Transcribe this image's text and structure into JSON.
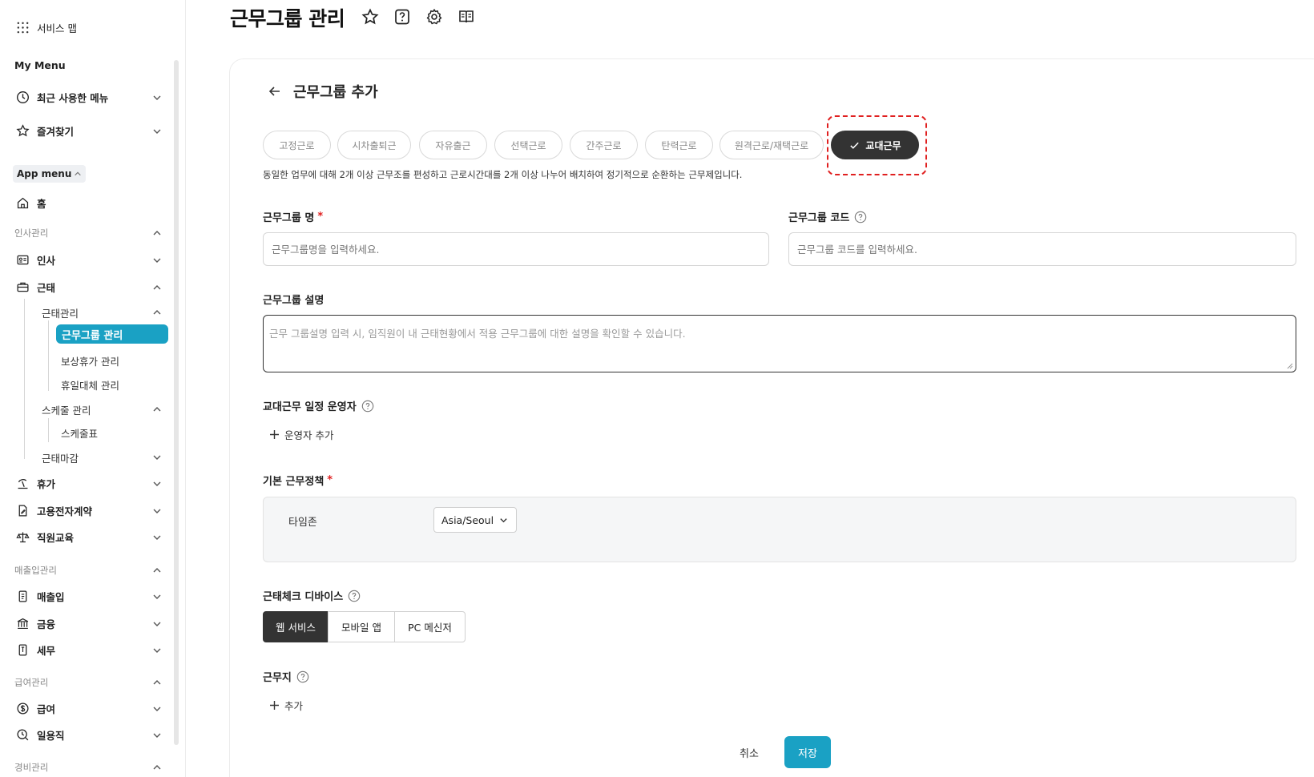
{
  "sidebar": {
    "service_map": "서비스 맵",
    "my_menu": "My Menu",
    "recent": "최근 사용한 메뉴",
    "favorites": "즐겨찾기",
    "app_menu": "App menu",
    "home": "홈",
    "sections": {
      "hr": "인사관리",
      "sales": "매출입관리",
      "payroll": "급여관리",
      "expense": "경비관리"
    },
    "items": {
      "insa": "인사",
      "geuntae": "근태",
      "geuntae_mgmt": "근태관리",
      "work_group": "근무그룹 관리",
      "comp_leave": "보상휴가 관리",
      "holiday_sub": "휴일대체 관리",
      "schedule_mgmt": "스케줄 관리",
      "schedule_table": "스케줄표",
      "geuntae_close": "근태마감",
      "vacation": "휴가",
      "contract": "고용전자계약",
      "education": "직원교육",
      "sales": "매출입",
      "finance": "금융",
      "tax": "세무",
      "salary": "급여",
      "daily": "일용직"
    }
  },
  "header": {
    "title": "근무그룹 관리"
  },
  "form": {
    "back_title": "근무그룹 추가",
    "chips": [
      "고정근로",
      "시차출퇴근",
      "자유출근",
      "선택근로",
      "간주근로",
      "탄력근로",
      "원격근로/재택근로",
      "교대근무"
    ],
    "selected_chip": "교대근무",
    "description": "동일한 업무에 대해 2개 이상 근무조를 편성하고 근로시간대를 2개 이상 나누어 배치하여 정기적으로 순환하는 근무제입니다.",
    "name_label": "근무그룹 명",
    "name_placeholder": "근무그룹명을 입력하세요.",
    "code_label": "근무그룹 코드",
    "code_placeholder": "근무그룹 코드를 입력하세요.",
    "desc_label": "근무그룹 설명",
    "desc_placeholder": "근무 그룹설명 입력 시, 임직원이 내 근태현황에서 적용 근무그룹에 대한 설명을 확인할 수 있습니다.",
    "operator_label": "교대근무 일정 운영자",
    "operator_add": "운영자 추가",
    "policy_label": "기본 근무정책",
    "timezone_label": "타임존",
    "timezone_value": "Asia/Seoul",
    "device_label": "근태체크 디바이스",
    "devices": [
      "웹 서비스",
      "모바일 앱",
      "PC 메신저"
    ],
    "workplace_label": "근무지",
    "workplace_add": "추가",
    "required_mark": "*",
    "cancel": "취소",
    "save": "저장"
  },
  "colors": {
    "accent": "#1aa1c4",
    "dark": "#333333",
    "required": "#e02020"
  }
}
